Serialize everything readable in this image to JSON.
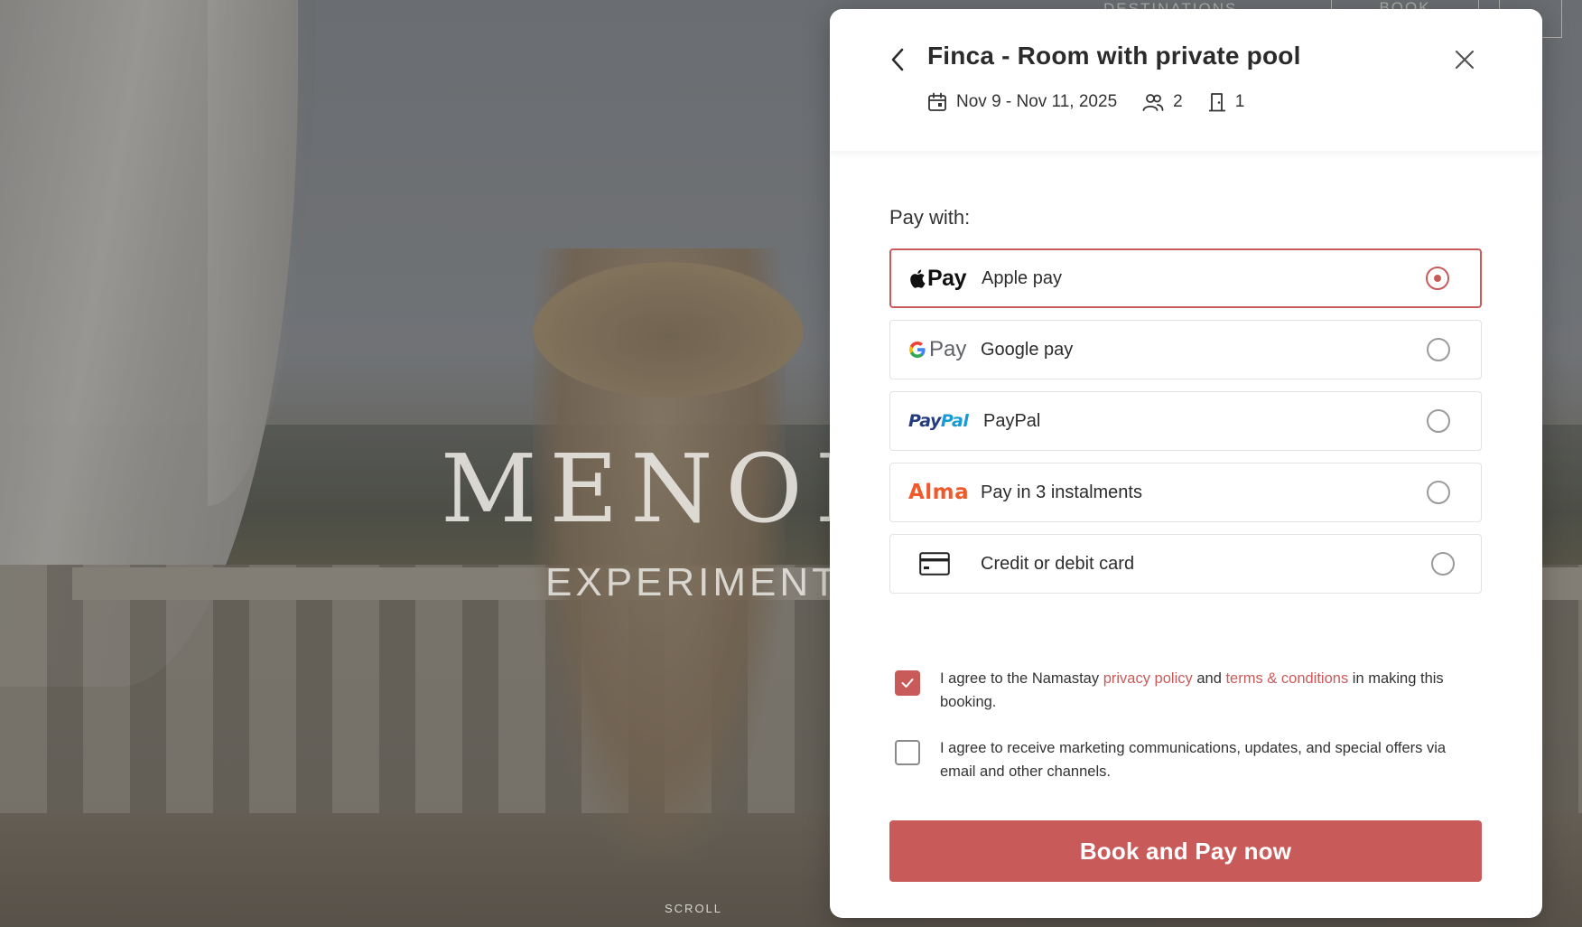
{
  "background": {
    "brand": "MENOR",
    "brand_sub": "EXPERIMENTAL",
    "scroll": "SCROLL",
    "nav_destinations": "DESTINATIONS",
    "nav_book": "BOOK"
  },
  "modal": {
    "title": "Finca - Room with private pool",
    "dates": "Nov 9 - Nov 11, 2025",
    "guests": "2",
    "rooms": "1",
    "pay_with": "Pay with:",
    "options": [
      {
        "logo": "Pay",
        "label": "Apple pay",
        "selected": true
      },
      {
        "logo": "Pay",
        "label": "Google pay",
        "selected": false
      },
      {
        "logo": "PayPal",
        "label": "PayPal",
        "selected": false
      },
      {
        "logo": "Alma",
        "label": "Pay in 3 instalments",
        "selected": false
      },
      {
        "logo": "card-icon",
        "label": "Credit or debit card",
        "selected": false
      }
    ],
    "consent_terms": {
      "checked": true,
      "text_before": "I agree to the Namastay",
      "privacy_link": "privacy policy",
      "text_and": "and",
      "terms_link": "terms & conditions",
      "text_after": "in making this booking."
    },
    "consent_marketing": {
      "checked": false,
      "text": "I agree to receive marketing communications, updates, and special offers via email and other channels."
    },
    "cta_label": "Book and Pay now"
  },
  "colors": {
    "accent": "#c95a5a",
    "text": "#2b2b2b",
    "border": "#e2e2e2",
    "paypal_dark": "#253b80",
    "paypal_light": "#179bd7",
    "alma": "#f05a2a"
  }
}
